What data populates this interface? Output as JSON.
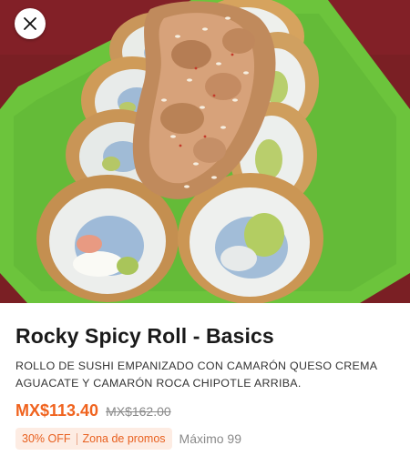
{
  "product": {
    "name": "Rocky Spicy Roll - Basics",
    "description": "ROLLO DE SUSHI EMPANIZADO CON CAMARÓN QUESO CREMA AGUACATE Y CAMARÓN ROCA CHIPOTLE ARRIBA.",
    "price": "MX$113.40",
    "original_price": "MX$162.00",
    "discount_tag": "30% OFF",
    "promo_tag": "Zona de promos",
    "limit": "Máximo 99"
  },
  "colors": {
    "accent": "#f0631e",
    "plate": "#6cc43c",
    "tablecloth": "#7a1f24"
  },
  "icons": {
    "close": "close-icon"
  }
}
